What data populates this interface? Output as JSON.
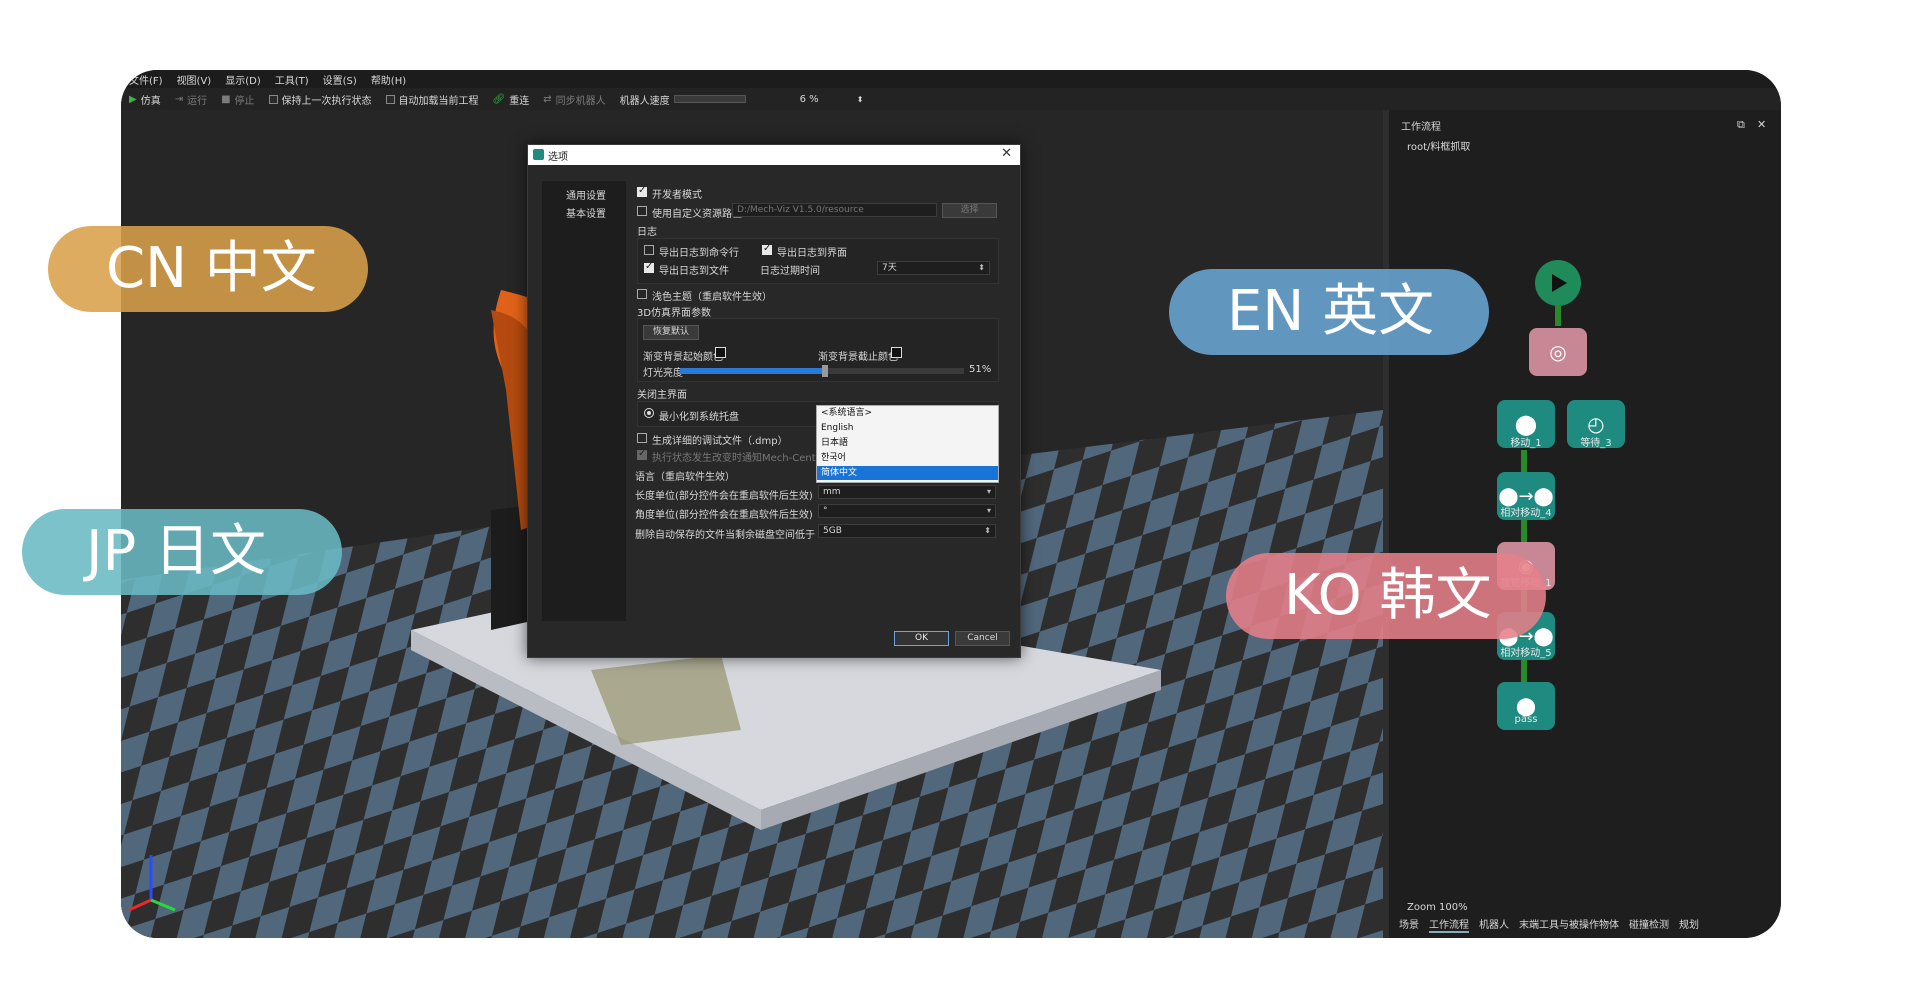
{
  "menu": [
    "文件(F)",
    "视图(V)",
    "显示(D)",
    "工具(T)",
    "设置(S)",
    "帮助(H)"
  ],
  "toolbar": {
    "sim": "仿真",
    "run": "运行",
    "stop": "停止",
    "keep_state": "保持上一次执行状态",
    "auto_load": "自动加载当前工程",
    "reconnect": "重连",
    "sync_robot": "同步机器人",
    "robot_speed": "机器人速度",
    "speed_value": "6 %"
  },
  "workflow_panel": {
    "title": "工作流程",
    "path": "root/料框抓取",
    "zoom": "Zoom 100%",
    "nodes": [
      "移动_1",
      "等待_3",
      "相对移动_4",
      "视觉移动_1",
      "相对移动_5",
      "pass"
    ],
    "tabs": [
      "场景",
      "工作流程",
      "机器人",
      "末端工具与被操作物体",
      "碰撞检测",
      "规划"
    ]
  },
  "dialog": {
    "title": "选项",
    "nav": [
      "通用设置",
      "基本设置"
    ],
    "dev_mode": "开发者模式",
    "custom_resource": "使用自定义资源路径",
    "resource_path": "D:/Mech-Viz V1.5.0/resource",
    "choose_button": "选择",
    "log_section": "日志",
    "log_to_cmd": "导出日志到命令行",
    "log_to_ui": "导出日志到界面",
    "log_to_file": "导出日志到文件",
    "log_expire_label": "日志过期时间",
    "log_expire_value": "7天",
    "light_theme": "浅色主题（重启软件生效）",
    "sim3d_section": "3D仿真界面参数",
    "restore_default": "恢复默认",
    "bg_start_color": "渐变背景起始颜色",
    "bg_end_color": "渐变背景截止颜色",
    "light_brightness": "灯光亮度",
    "brightness_value": "51%",
    "brightness_level": 0.51,
    "close_main_section": "关闭主界面",
    "minimize_tray": "最小化到系统托盘",
    "gen_dump": "生成详细的调试文件（.dmp）",
    "notify_center": "执行状态发生改变时通知Mech-Center",
    "language_label": "语言（重启软件生效）",
    "language_options": [
      "<系统语言>",
      "English",
      "日本語",
      "한국어",
      "简体中文"
    ],
    "language_selected": "简体中文",
    "length_unit_label": "长度单位(部分控件会在重启软件后生效)",
    "length_unit_value": "mm",
    "angle_unit_label": "角度单位(部分控件会在重启软件后生效)",
    "angle_unit_value": "°",
    "disk_label": "删除自动保存的文件当剩余磁盘空间低于",
    "disk_value": "5GB",
    "ok": "OK",
    "cancel": "Cancel"
  },
  "pills": {
    "cn": "CN 中文",
    "en": "EN 英文",
    "jp": "JP 日文",
    "ko": "KO 韩文"
  },
  "colors": {
    "cn_pill": "#d8a14a",
    "en_pill": "#6aa6d4",
    "jp_pill": "#6ab9c4",
    "ko_pill": "#e57f8a",
    "node_teal": "#1f8a80",
    "accent_blue": "#1a74d8"
  }
}
